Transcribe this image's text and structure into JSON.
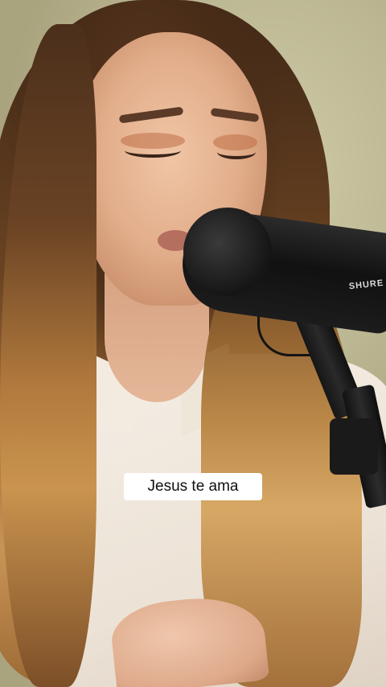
{
  "video": {
    "caption": "Jesus te ama",
    "mic_brand": "SHURE"
  },
  "colors": {
    "background": "#b9b48f",
    "caption_bg": "#ffffff",
    "caption_text": "#111111"
  }
}
